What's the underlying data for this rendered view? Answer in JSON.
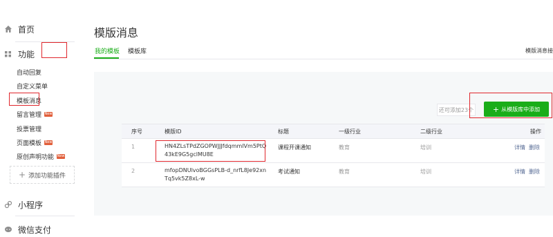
{
  "sidebar": {
    "home": "首页",
    "features": "功能",
    "items": [
      {
        "label": "自动回复",
        "new": false
      },
      {
        "label": "自定义菜单",
        "new": false
      },
      {
        "label": "模板消息",
        "new": false
      },
      {
        "label": "留言管理",
        "new": true
      },
      {
        "label": "投票管理",
        "new": false
      },
      {
        "label": "页面模板",
        "new": true
      },
      {
        "label": "原创声明功能",
        "new": true
      }
    ],
    "new_badge": "New",
    "add_plugin": "添加功能插件",
    "mini_program": "小程序",
    "wechat_pay": "微信支付"
  },
  "main": {
    "title": "模版消息",
    "tabs": [
      {
        "label": "我的模板"
      },
      {
        "label": "模板库"
      }
    ],
    "tab_right": "模版消息接",
    "limit_text": "还可添加23个",
    "add_button": "从模版库中添加",
    "table": {
      "headers": [
        "序号",
        "模版ID",
        "标题",
        "一级行业",
        "二级行业",
        "操作"
      ],
      "rows": [
        {
          "no": "1",
          "id": "HN4ZLsTPdZGOPWJJJfdqmmlVm5PtQ43kE9G5gclMU8E",
          "title": "课程开课通知",
          "ind1": "教育",
          "ind2": "培训",
          "op_detail": "详情",
          "op_delete": "删除"
        },
        {
          "no": "2",
          "id": "mfopDNUlvoBGGsPLB-d_nrfL8Je92xnTq5vk5Z8xL-w",
          "title": "考试通知",
          "ind1": "教育",
          "ind2": "培训",
          "op_detail": "详情",
          "op_delete": "删除"
        }
      ]
    }
  },
  "colors": {
    "accent": "#1aad19",
    "highlight": "#e0252b",
    "link": "#576b95",
    "badge": "#e15f3b"
  }
}
